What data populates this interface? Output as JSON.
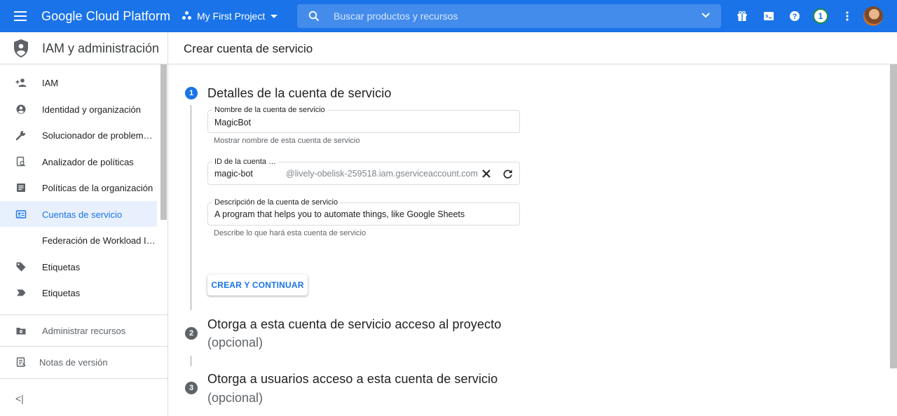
{
  "topbar": {
    "brand": "Google Cloud Platform",
    "project": "My First Project",
    "search_placeholder": "Buscar productos y recursos",
    "notification_count": "1",
    "accent": "#1a73e8"
  },
  "sidebar": {
    "title": "IAM y administración",
    "items": [
      {
        "label": "IAM",
        "icon": "add-person-icon"
      },
      {
        "label": "Identidad y organización",
        "icon": "account-circle-icon"
      },
      {
        "label": "Solucionador de problem…",
        "icon": "wrench-icon"
      },
      {
        "label": "Analizador de políticas",
        "icon": "document-search-icon"
      },
      {
        "label": "Políticas de la organización",
        "icon": "list-document-icon"
      },
      {
        "label": "Cuentas de servicio",
        "icon": "service-account-icon"
      },
      {
        "label": "Federación de Workload I…",
        "icon": ""
      },
      {
        "label": "Etiquetas",
        "icon": "tag-icon"
      },
      {
        "label": "Etiquetas",
        "icon": "label-icon"
      }
    ],
    "manage_resources": "Administrar recursos",
    "release_notes": "Notas de versión",
    "collapse": "<|"
  },
  "main": {
    "page_title": "Crear cuenta de servicio",
    "step1": {
      "number": "1",
      "title": "Detalles de la cuenta de servicio",
      "name_label": "Nombre de la cuenta de servicio",
      "name_value": "MagicBot",
      "name_hint": "Mostrar nombre de esta cuenta de servicio",
      "id_label": "ID de la cuenta …",
      "id_value": "magic-bot",
      "id_suffix": "@lively-obelisk-259518.iam.gserviceaccount.com",
      "desc_label": "Descripción de la cuenta de servicio",
      "desc_value": "A program that helps you to automate things, like Google Sheets",
      "desc_hint": "Describe lo que hará esta cuenta de servicio",
      "create_button": "CREAR Y CONTINUAR"
    },
    "step2": {
      "number": "2",
      "title": "Otorga a esta cuenta de servicio acceso al proyecto",
      "optional": "(opcional)"
    },
    "step3": {
      "number": "3",
      "title": "Otorga a usuarios acceso a esta cuenta de servicio",
      "optional": "(opcional)"
    }
  }
}
